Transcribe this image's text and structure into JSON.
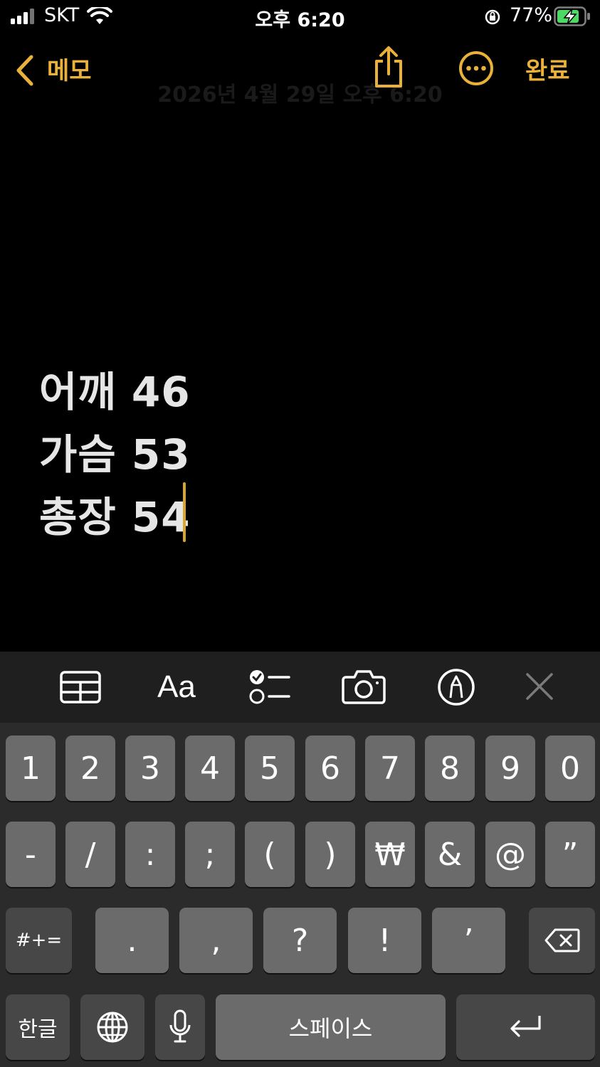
{
  "status_bar": {
    "carrier": "SKT",
    "time": "오후 6:20",
    "battery": "77%"
  },
  "nav": {
    "back_label": "메모",
    "done_label": "완료",
    "faded_date": "2026년 4월 29일 오후 6:20"
  },
  "note": {
    "lines": [
      "어깨 46",
      "가슴 53",
      "총장 54"
    ]
  },
  "toolbar": {
    "format_label": "Aa",
    "items": [
      "table-icon",
      "format-text",
      "checklist-icon",
      "camera-icon",
      "markup-pen-icon",
      "close-icon"
    ]
  },
  "keyboard": {
    "row1": [
      "1",
      "2",
      "3",
      "4",
      "5",
      "6",
      "7",
      "8",
      "9",
      "0"
    ],
    "row2": [
      "-",
      "/",
      ":",
      ";",
      "(",
      ")",
      "₩",
      "&",
      "@",
      "”"
    ],
    "row3_mode": "#+=",
    "row3": [
      ".",
      ",",
      "?",
      "!",
      "’"
    ],
    "lang_key": "한글",
    "space_label": "스페이스"
  },
  "colors": {
    "accent": "#e9b13a",
    "background": "#000000",
    "key": "#6b6b6b",
    "key_dark": "#474747",
    "toolbar": "#1f1f1f"
  }
}
